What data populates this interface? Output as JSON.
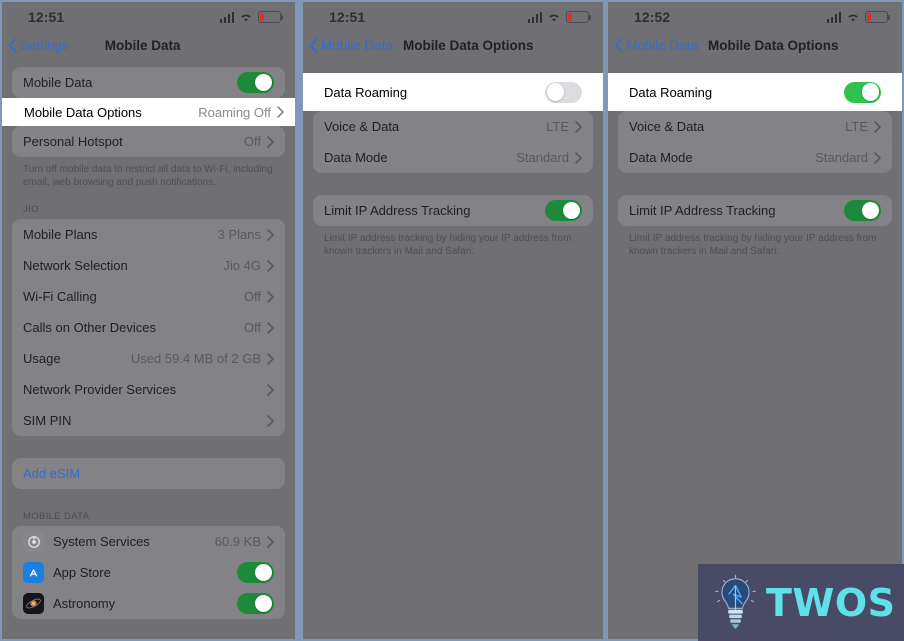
{
  "panels": [
    {
      "id": "settings-mobile-data",
      "status": {
        "time": "12:51",
        "signal_icon": "cellular-bars-icon",
        "wifi_icon": "wifi-icon",
        "battery_icon": "battery-low-icon",
        "battery_level_percent": 18
      },
      "nav": {
        "back_label": "Settings",
        "back_icon": "chevron-left-icon",
        "title": "Mobile Data"
      },
      "groups": [
        {
          "rows": [
            {
              "label": "Mobile Data",
              "control": "toggle",
              "toggle_on": true
            },
            {
              "label": "Mobile Data Options",
              "value": "Roaming Off",
              "control": "chevron",
              "highlighted": true
            },
            {
              "label": "Personal Hotspot",
              "value": "Off",
              "control": "chevron"
            }
          ],
          "footer": "Turn off mobile data to restrict all data to Wi-Fi, including email, web browsing and push notifications."
        },
        {
          "header": "JIO",
          "rows": [
            {
              "label": "Mobile Plans",
              "value": "3 Plans",
              "control": "chevron"
            },
            {
              "label": "Network Selection",
              "value": "Jio 4G",
              "control": "chevron"
            },
            {
              "label": "Wi-Fi Calling",
              "value": "Off",
              "control": "chevron"
            },
            {
              "label": "Calls on Other Devices",
              "value": "Off",
              "control": "chevron"
            },
            {
              "label": "Usage",
              "value": "Used 59.4 MB of 2 GB",
              "control": "chevron"
            },
            {
              "label": "Network Provider Services",
              "value": "",
              "control": "chevron"
            },
            {
              "label": "SIM PIN",
              "value": "",
              "control": "chevron"
            }
          ]
        },
        {
          "rows": [
            {
              "label": "Add eSIM",
              "link": true
            }
          ]
        },
        {
          "header": "MOBILE DATA",
          "rows": [
            {
              "label": "System Services",
              "value": "60.9 KB",
              "control": "chevron",
              "icon": "system-services-icon"
            },
            {
              "label": "App Store",
              "control": "toggle",
              "toggle_on": true,
              "icon": "app-store-icon"
            },
            {
              "label": "Astronomy",
              "control": "toggle",
              "toggle_on": true,
              "icon": "astronomy-icon"
            }
          ]
        }
      ]
    },
    {
      "id": "mobile-data-options-roaming-off",
      "status": {
        "time": "12:51",
        "signal_icon": "cellular-bars-icon",
        "wifi_icon": "wifi-icon",
        "battery_icon": "battery-low-icon",
        "battery_level_percent": 18
      },
      "nav": {
        "back_label": "Mobile Data",
        "back_icon": "chevron-left-icon",
        "title": "Mobile Data Options"
      },
      "groups": [
        {
          "rows": [
            {
              "label": "Data Roaming",
              "control": "toggle",
              "toggle_on": false,
              "highlighted": true
            },
            {
              "label": "Voice & Data",
              "value": "LTE",
              "control": "chevron"
            },
            {
              "label": "Data Mode",
              "value": "Standard",
              "control": "chevron"
            }
          ]
        },
        {
          "rows": [
            {
              "label": "Limit IP Address Tracking",
              "control": "toggle",
              "toggle_on": true
            }
          ],
          "footer": "Limit IP address tracking by hiding your IP address from known trackers in Mail and Safari."
        }
      ]
    },
    {
      "id": "mobile-data-options-roaming-on",
      "status": {
        "time": "12:52",
        "signal_icon": "cellular-bars-icon",
        "wifi_icon": "wifi-icon",
        "battery_icon": "battery-low-icon",
        "battery_level_percent": 18
      },
      "nav": {
        "back_label": "Mobile Data",
        "back_icon": "chevron-left-icon",
        "title": "Mobile Data Options"
      },
      "groups": [
        {
          "rows": [
            {
              "label": "Data Roaming",
              "control": "toggle",
              "toggle_on": true,
              "highlighted": true
            },
            {
              "label": "Voice & Data",
              "value": "LTE",
              "control": "chevron"
            },
            {
              "label": "Data Mode",
              "value": "Standard",
              "control": "chevron"
            }
          ]
        },
        {
          "rows": [
            {
              "label": "Limit IP Address Tracking",
              "control": "toggle",
              "toggle_on": true
            }
          ],
          "footer": "Limit IP address tracking by hiding your IP address from known trackers in Mail and Safari."
        }
      ]
    }
  ],
  "watermark": {
    "text": "TWOS",
    "icon": "lightbulb-icon",
    "background": "#494a66",
    "text_color": "#5ee2e8"
  },
  "colors": {
    "toggle_on": "#2ec24f",
    "toggle_on_dimmed": "#1d8a3b",
    "toggle_off": "#dcdce0",
    "link_blue": "#2f6fd0",
    "battery_red": "#d8312c",
    "dim_overlay": "#6f6f74"
  }
}
